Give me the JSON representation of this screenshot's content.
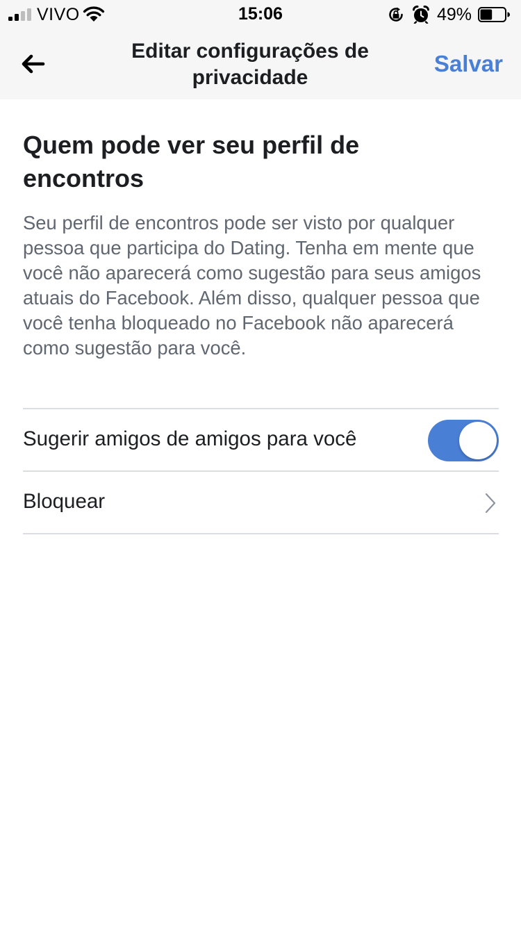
{
  "status_bar": {
    "carrier": "VIVO",
    "time": "15:06",
    "battery_percent": "49%",
    "battery_level": 0.49,
    "icons": [
      "signal-icon",
      "wifi-icon",
      "orientation-lock-icon",
      "alarm-icon",
      "battery-icon"
    ]
  },
  "nav": {
    "title": "Editar configurações de privacidade",
    "save_label": "Salvar",
    "back_icon": "back-arrow-icon"
  },
  "section": {
    "heading": "Quem pode ver seu perfil de encontros",
    "description": "Seu perfil de encontros pode ser visto por qualquer pessoa que participa do Dating. Tenha em mente que você não aparecerá como sugestão para seus amigos atuais do Facebook. Além disso, qualquer pessoa que você tenha bloqueado no Facebook não aparecerá como sugestão para você."
  },
  "settings": {
    "suggest_friends": {
      "label": "Sugerir amigos de amigos para você",
      "enabled": true
    },
    "block": {
      "label": "Bloquear",
      "icon": "chevron-right-icon"
    }
  },
  "colors": {
    "accent": "#4a7fd6",
    "bar_background": "#f6f6f6",
    "text_primary": "#1c1e21",
    "text_secondary": "#606770",
    "divider": "#dadde1"
  }
}
